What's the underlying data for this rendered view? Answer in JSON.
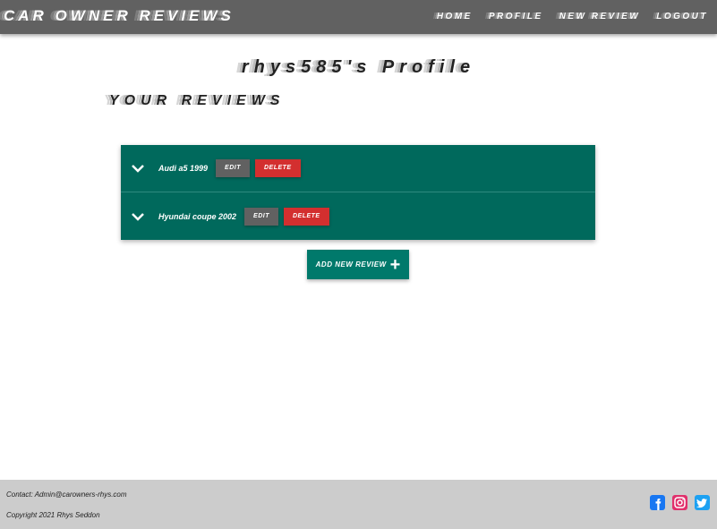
{
  "nav": {
    "brand": "Car Owner Reviews",
    "links": [
      "Home",
      "Profile",
      "New Review",
      "Logout"
    ]
  },
  "page": {
    "title": "rhys585's Profile",
    "section_title": "Your Reviews"
  },
  "reviews": [
    {
      "title": "Audi a5 1999",
      "edit_label": "Edit",
      "delete_label": "Delete"
    },
    {
      "title": "Hyundai coupe 2002",
      "edit_label": "Edit",
      "delete_label": "Delete"
    }
  ],
  "add_button": {
    "label": "Add new review",
    "icon": "plus-icon"
  },
  "footer": {
    "contact": "Contact: Admin@carowners-rhys.com",
    "copyright": "Copyright 2021 Rhys Seddon",
    "social_icons": [
      "facebook-icon",
      "instagram-icon",
      "twitter-icon"
    ]
  },
  "colors": {
    "navbar": "#616161",
    "accent": "#00695c",
    "delete": "#d32f2f",
    "footer": "#cccccc",
    "facebook": "#1877f2",
    "instagram": "#e1306c",
    "twitter": "#1da1f2"
  }
}
